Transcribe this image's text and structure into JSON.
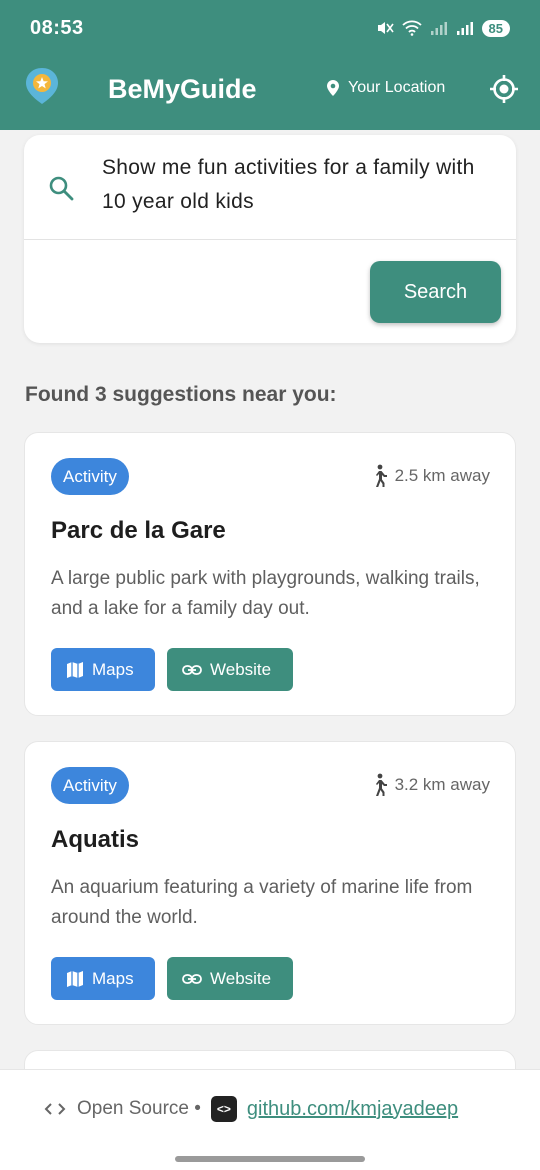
{
  "status_bar": {
    "time": "08:53",
    "battery": "85"
  },
  "app_bar": {
    "title": "BeMyGuide",
    "location_label": "Your Location"
  },
  "search": {
    "query": "Show me fun activities for a family with 10 year old kids",
    "button_label": "Search"
  },
  "results": {
    "heading": "Found 3 suggestions near you:",
    "items": [
      {
        "category": "Activity",
        "distance": "2.5 km away",
        "title": "Parc de la Gare",
        "description": "A large public park with playgrounds, walking trails, and a lake for a family day out.",
        "maps_label": "Maps",
        "website_label": "Website"
      },
      {
        "category": "Activity",
        "distance": "3.2 km away",
        "title": "Aquatis",
        "description": "An aquarium featuring a variety of marine life from around the world.",
        "maps_label": "Maps",
        "website_label": "Website"
      }
    ]
  },
  "footer": {
    "open_source_label": "Open Source •",
    "github_link": "github.com/kmjayadeep"
  },
  "colors": {
    "primary": "#3e8e7e",
    "accent_blue": "#3d86dc",
    "logo_pin": "#5bb5d9",
    "logo_star": "#f4b73c"
  },
  "icons": {
    "logo": "map-pin-star-icon",
    "location": "location-pin-icon",
    "gps": "crosshair-icon",
    "search": "search-icon",
    "distance": "walking-icon",
    "maps": "map-icon",
    "website": "link-icon",
    "open_source": "code-brackets-icon"
  }
}
